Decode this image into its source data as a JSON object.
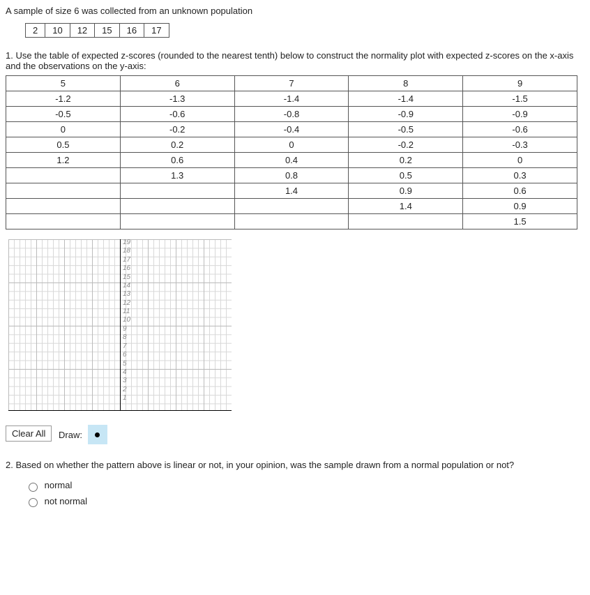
{
  "intro": "A sample of size 6 was collected from an unknown population",
  "sample": [
    "2",
    "10",
    "12",
    "15",
    "16",
    "17"
  ],
  "q1": "1. Use the table of expected z-scores (rounded to the nearest tenth) below to construct the normality plot with expected z-scores on the x-axis and the observations on the y-axis:",
  "ztable": {
    "headers": [
      "5",
      "6",
      "7",
      "8",
      "9"
    ],
    "rows": [
      [
        "-1.2",
        "-1.3",
        "-1.4",
        "-1.4",
        "-1.5"
      ],
      [
        "-0.5",
        "-0.6",
        "-0.8",
        "-0.9",
        "-0.9"
      ],
      [
        "0",
        "-0.2",
        "-0.4",
        "-0.5",
        "-0.6"
      ],
      [
        "0.5",
        "0.2",
        "0",
        "-0.2",
        "-0.3"
      ],
      [
        "1.2",
        "0.6",
        "0.4",
        "0.2",
        "0"
      ],
      [
        "",
        "1.3",
        "0.8",
        "0.5",
        "0.3"
      ],
      [
        "",
        "",
        "1.4",
        "0.9",
        "0.6"
      ],
      [
        "",
        "",
        "",
        "1.4",
        "0.9"
      ],
      [
        "",
        "",
        "",
        "",
        "1.5"
      ]
    ]
  },
  "chart_data": {
    "type": "scatter",
    "title": "",
    "xlabel": "",
    "ylabel": "",
    "xlim": [
      -2,
      2
    ],
    "ylim": [
      0,
      19
    ],
    "yticks": [
      1,
      2,
      3,
      4,
      5,
      6,
      7,
      8,
      9,
      10,
      11,
      12,
      13,
      14,
      15,
      16,
      17,
      18,
      19
    ],
    "series": []
  },
  "controls": {
    "clear": "Clear All",
    "draw_label": "Draw:"
  },
  "q2": "2. Based on whether the pattern above is linear or not, in your opinion, was the sample drawn from a normal population or not?",
  "options": {
    "a": "normal",
    "b": "not normal"
  }
}
